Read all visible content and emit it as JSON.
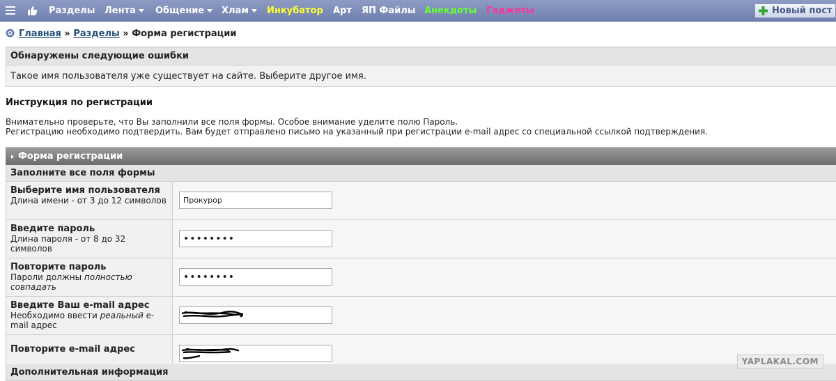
{
  "nav": {
    "items": [
      {
        "label": "Разделы",
        "color": "#ffffff",
        "dropdown": false
      },
      {
        "label": "Лента",
        "color": "#ffffff",
        "dropdown": true
      },
      {
        "label": "Общение",
        "color": "#ffffff",
        "dropdown": true
      },
      {
        "label": "Хлам",
        "color": "#ffffff",
        "dropdown": true
      },
      {
        "label": "Инкубатор",
        "color": "#ffff33",
        "dropdown": false
      },
      {
        "label": "Арт",
        "color": "#ffffff",
        "dropdown": false
      },
      {
        "label": "ЯП Файлы",
        "color": "#ffffff",
        "dropdown": false
      },
      {
        "label": "Анекдоты",
        "color": "#66ff33",
        "dropdown": false
      },
      {
        "label": "Гаджеты",
        "color": "#ff3399",
        "dropdown": false
      }
    ],
    "new_post_label": "Новый пост"
  },
  "breadcrumb": {
    "home": "Главная",
    "sep1": " » ",
    "sections": "Разделы",
    "sep2": " » ",
    "current": "Форма регистрации"
  },
  "errors": {
    "title": "Обнаружены следующие ошибки",
    "message": "Такое имя пользователя уже существует на сайте. Выберите другое имя."
  },
  "instructions": {
    "title": "Инструкция по регистрации",
    "line1": "Внимательно проверьте, что Вы заполнили все поля формы. Особое внимание уделите полю Пароль.",
    "line2": "Регистрацию необходимо подтвердить. Вам будет отправлено письмо на указанный при регистрации e-mail адрес со специальной ссылкой подтверждения."
  },
  "form": {
    "header": "Форма регистрации",
    "section_fill": "Заполните все поля формы",
    "section_extra": "Дополнительная информация",
    "username": {
      "label": "Выберите имя пользователя",
      "hint": "Длина имени - от 3 до 12 символов",
      "value": "Прокурор"
    },
    "password": {
      "label": "Введите пароль",
      "hint": "Длина пароля - от 8 до 32 символов",
      "value": "12345678"
    },
    "password2": {
      "label": "Повторите пароль",
      "hint_pre": "Пароли должны ",
      "hint_em": "полностью совпадать",
      "value": "12345678"
    },
    "email": {
      "label": "Введите Ваш e-mail адрес",
      "hint_pre": "Необходимо ввести ",
      "hint_em": "реальный",
      "hint_post": " e-mail адрес"
    },
    "email2": {
      "label": "Повторите e-mail адрес"
    }
  },
  "watermark": "YAPLAKAL.COM"
}
